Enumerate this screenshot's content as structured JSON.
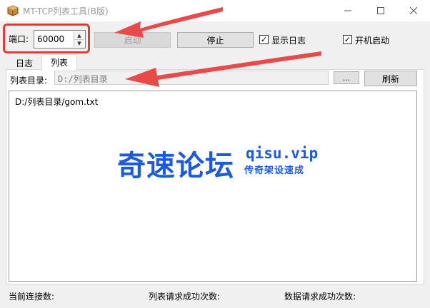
{
  "window": {
    "title": "MT-TCP列表工具(B版)",
    "icons": {
      "minimize": "minimize-icon",
      "maximize": "maximize-icon",
      "close": "close-icon"
    }
  },
  "toolbar": {
    "port_label": "端口:",
    "port_value": "60000",
    "start_label": "启动",
    "stop_label": "停止",
    "show_log_label": "显示日志",
    "show_log_checked": true,
    "auto_start_label": "开机启动",
    "auto_start_checked": true
  },
  "tabs": [
    {
      "label": "日志",
      "active": false
    },
    {
      "label": "列表",
      "active": true
    }
  ],
  "list_tab": {
    "dir_label": "列表目录:",
    "dir_value": "D:/列表目录",
    "browse_label": "...",
    "refresh_label": "刷新",
    "items": [
      "D:/列表目录/gom.txt"
    ]
  },
  "watermark": {
    "title": "奇速论坛",
    "url": "qisu.vip",
    "slogan": "传奇架设速成"
  },
  "status": {
    "connections_label": "当前连接数:",
    "list_success_label": "列表请求成功次数:",
    "data_success_label": "数据请求成功次数:"
  },
  "colors": {
    "highlight": "#e33a3a",
    "watermark": "#1e5bd8",
    "arrow": "#e84a4a"
  }
}
